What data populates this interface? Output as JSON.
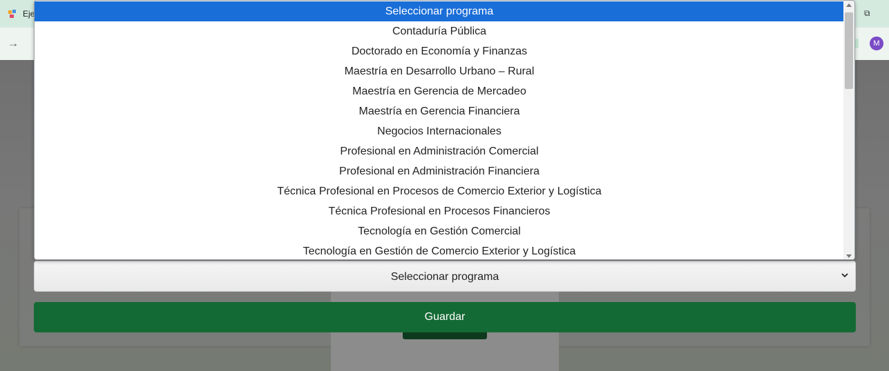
{
  "browser": {
    "tab_title": "Eje",
    "profile_initial": "M"
  },
  "dropdown": {
    "options": [
      "Seleccionar programa",
      "Contaduría Pública",
      "Doctorado en Economía y Finanzas",
      "Maestría en Desarrollo Urbano – Rural",
      "Maestría en Gerencia de Mercadeo",
      "Maestría en Gerencia Financiera",
      "Negocios Internacionales",
      "Profesional en Administración Comercial",
      "Profesional en Administración Financiera",
      "Técnica Profesional en Procesos de Comercio Exterior y Logística",
      "Técnica Profesional en Procesos Financieros",
      "Tecnología en Gestión Comercial",
      "Tecnología en Gestión de Comercio Exterior y Logística"
    ],
    "selected_index": 0
  },
  "form": {
    "select_value": "Seleccionar programa",
    "save_label": "Guardar"
  },
  "colors": {
    "highlight": "#1a6ed8",
    "save_button": "#146a34"
  },
  "icons": {
    "forward": "forward-arrow-icon",
    "restore": "restore-window-icon",
    "chevron": "chevron-down-icon"
  }
}
